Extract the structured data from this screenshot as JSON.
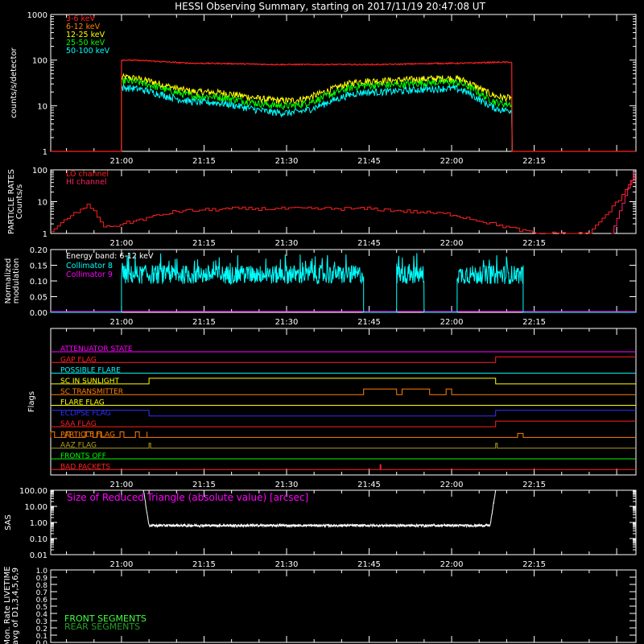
{
  "title": "HESSI Observing Summary, starting on 2017/11/19 20:47:08 UT",
  "time_ticks": [
    "21:00",
    "21:15",
    "21:30",
    "21:45",
    "22:00",
    "22:15"
  ],
  "colors": {
    "bg": "#000000",
    "axis": "#ffffff",
    "red": "#ff2020",
    "orange": "#ff7f00",
    "yellow": "#ffff00",
    "green": "#00ff00",
    "cyan": "#00ffff",
    "magenta": "#ff00ff",
    "crimson": "#ff2060",
    "blue": "#3030ff",
    "olive": "#b0a020",
    "lgreen": "#40ff40",
    "dgreen": "#20a020",
    "white": "#ffffff"
  },
  "chart_data": [
    {
      "type": "line",
      "id": "counts",
      "ylabel": "counts/s/detector",
      "yscale": "log",
      "ylim": [
        1,
        1000
      ],
      "xlim_minutes": [
        "20:47:08",
        "22:33:00"
      ],
      "y_tick_labels": [
        "1",
        "10",
        "100",
        "1000"
      ],
      "legend": [
        "3-6 keV",
        "6-12 keV",
        "12-25 keV",
        "25-50 keV",
        "50-100 keV"
      ],
      "legend_colors": [
        "red",
        "orange",
        "yellow",
        "green",
        "cyan"
      ],
      "series": [
        {
          "name": "6-12 keV",
          "color": "red",
          "x": [
            "21:00",
            "21:15",
            "21:30",
            "21:45",
            "22:00",
            "22:10"
          ],
          "y": [
            100,
            85,
            80,
            80,
            85,
            90
          ]
        },
        {
          "name": "12-25 keV",
          "color": "yellow",
          "x": [
            "21:00",
            "21:15",
            "21:30",
            "21:45",
            "22:00",
            "22:10"
          ],
          "y": [
            42,
            20,
            13,
            35,
            40,
            15
          ]
        },
        {
          "name": "25-50 keV",
          "color": "green",
          "x": [
            "21:00",
            "21:15",
            "21:30",
            "21:45",
            "22:00",
            "22:10"
          ],
          "y": [
            35,
            16,
            10,
            28,
            33,
            11
          ]
        },
        {
          "name": "50-100 keV",
          "color": "cyan",
          "x": [
            "21:00",
            "21:15",
            "21:30",
            "21:45",
            "22:00",
            "22:10"
          ],
          "y": [
            25,
            12,
            7,
            20,
            24,
            8
          ]
        }
      ]
    },
    {
      "type": "line",
      "id": "particle",
      "ylabel": [
        "PARTICLE RATES",
        "Counts/s"
      ],
      "yscale": "log",
      "ylim": [
        1,
        100
      ],
      "y_tick_labels": [
        "1",
        "10",
        "100"
      ],
      "legend": [
        "LO channel",
        "HI channel"
      ],
      "legend_colors": [
        "red",
        "crimson"
      ],
      "series": [
        {
          "name": "LO channel",
          "color": "red",
          "x": [
            "20:47",
            "20:50",
            "20:54",
            "20:57",
            "21:00",
            "21:10",
            "21:20",
            "21:45",
            "22:00",
            "22:15",
            "22:25",
            "22:30",
            "22:33"
          ],
          "y": [
            1,
            3,
            8,
            1.5,
            2,
            5,
            6,
            6,
            4,
            1,
            1,
            10,
            60
          ]
        },
        {
          "name": "HI channel",
          "color": "crimson",
          "x": [
            "22:29",
            "22:31",
            "22:33"
          ],
          "y": [
            1,
            20,
            80
          ]
        }
      ]
    },
    {
      "type": "line",
      "id": "modulation",
      "ylabel": [
        "Normalized",
        "modulation"
      ],
      "ylim": [
        0.0,
        0.2
      ],
      "y_tick_labels": [
        "0.00",
        "0.05",
        "0.10",
        "0.15",
        "0.20"
      ],
      "annotation": "Energy band: 6-12 keV",
      "legend": [
        "Collimator 8",
        "Collimator 9"
      ],
      "legend_colors": [
        "cyan",
        "magenta"
      ],
      "series": [
        {
          "name": "Collimator 8",
          "color": "cyan",
          "segments": [
            [
              "21:00",
              "21:44"
            ],
            [
              "21:50",
              "21:55"
            ],
            [
              "22:01",
              "22:13"
            ]
          ],
          "y": [
            0.12
          ]
        },
        {
          "name": "Collimator 9",
          "color": "magenta",
          "y": [
            0.0
          ]
        }
      ]
    },
    {
      "type": "line",
      "id": "flags",
      "ylabel": "Flags",
      "rows": [
        {
          "label": "ATTENUATOR STATE",
          "color": "magenta"
        },
        {
          "label": "GAP FLAG",
          "color": "red"
        },
        {
          "label": "POSSIBLE FLARE",
          "color": "cyan"
        },
        {
          "label": "SC IN SUNLIGHT",
          "color": "yellow"
        },
        {
          "label": "SC TRANSMITTER",
          "color": "orange"
        },
        {
          "label": "FLARE FLAG",
          "color": "yellow"
        },
        {
          "label": "ECLIPSE FLAG",
          "color": "blue"
        },
        {
          "label": "SAA FLAG",
          "color": "red"
        },
        {
          "label": "PARTICLE FLAG",
          "color": "orange"
        },
        {
          "label": "AAZ FLAG",
          "color": "olive"
        },
        {
          "label": "FRONTS OFF",
          "color": "green"
        },
        {
          "label": "BAD PACKETS",
          "color": "red"
        }
      ]
    },
    {
      "type": "line",
      "id": "sas",
      "ylabel": "SAS",
      "yscale": "log",
      "ylim": [
        0.01,
        100
      ],
      "y_tick_labels": [
        "0.01",
        "0.10",
        "1.00",
        "10.00",
        "100.00"
      ],
      "annotation": "Size of Reduced Triangle (absolute value) [arcsec]",
      "series": [
        {
          "name": "",
          "color": "white",
          "x": [
            "21:04",
            "21:05",
            "21:10",
            "22:08",
            "22:09"
          ],
          "y": [
            100,
            0.7,
            0.6,
            0.7,
            100
          ]
        }
      ]
    },
    {
      "type": "line",
      "id": "livetime",
      "ylabel": [
        "Mon. Rate LIVETIME",
        "avg of D1,3,4,5,6,9"
      ],
      "ylim": [
        0.0,
        1.0
      ],
      "y_tick_labels": [
        "0.0",
        "0.1",
        "0.2",
        "0.3",
        "0.4",
        "0.5",
        "0.6",
        "0.7",
        "0.8",
        "0.9",
        "1.0"
      ],
      "legend": [
        "FRONT SEGMENTS",
        "REAR SEGMENTS"
      ],
      "legend_colors": [
        "lgreen",
        "dgreen"
      ],
      "series": []
    }
  ]
}
